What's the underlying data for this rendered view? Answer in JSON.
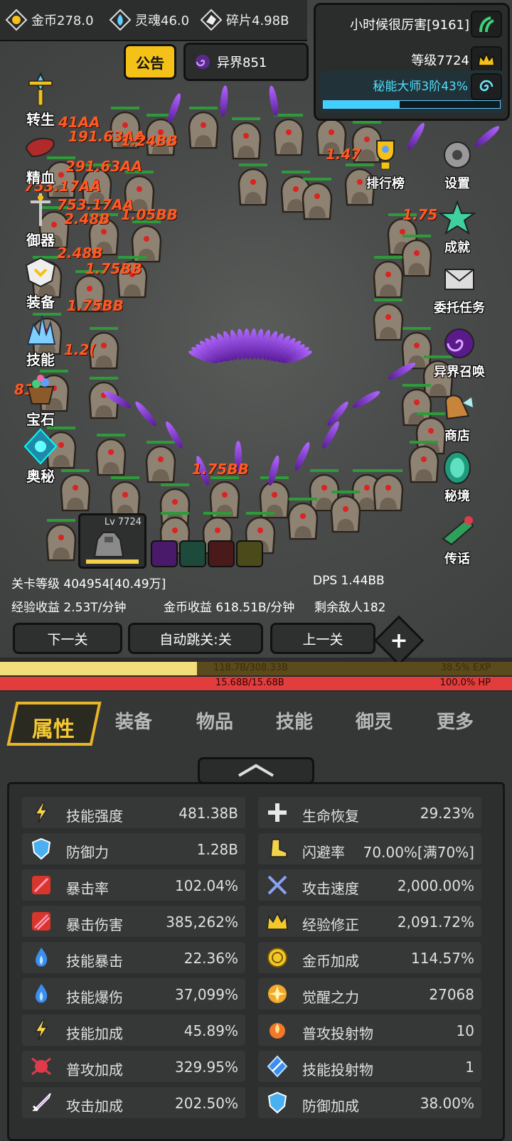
{
  "resources": [
    {
      "icon": "gold-coin-icon",
      "text": "金币278.0"
    },
    {
      "icon": "soul-icon",
      "text": "灵魂46.0"
    },
    {
      "icon": "fragment-icon",
      "text": "碎片4.98B"
    }
  ],
  "boss": {
    "title": "小时候很厉害[9161]",
    "level": "等级7724",
    "rank": "秘能大师3阶43%",
    "progress": 0.43
  },
  "notice_label": "公告",
  "otherworld_label": "异界851",
  "left_menu": [
    "转生",
    "精血",
    "御器",
    "装备",
    "技能",
    "宝石",
    "奥秘"
  ],
  "right_menu": [
    "排行榜",
    "设置",
    "成就",
    "委托任务",
    "异界召唤",
    "商店",
    "秘境",
    "传话"
  ],
  "damage_numbers": [
    "41AA",
    "191.63AA",
    "1.24BB",
    "291.63AA",
    "753.17AA",
    "753.17AA",
    "2.48B",
    "1.05BB",
    "2.48B",
    "1.75BB",
    "1.75BB",
    "1.75BB",
    "818",
    "1.2(",
    "1.47",
    "1.75"
  ],
  "hero": {
    "level": "Lv 7724"
  },
  "stage": {
    "level": "关卡等级 404954[40.49万]",
    "dps": "DPS 1.44BB",
    "exp_rate": "经验收益 2.53T/分钟",
    "gold_rate": "金币收益 618.51B/分钟",
    "enemies_left": "剩余敌人182"
  },
  "nav": {
    "next": "下一关",
    "auto": "自动跳关:关",
    "prev": "上一关",
    "plus": "+"
  },
  "exp_bar": {
    "value": "118.7B/308.33B",
    "percent": "38.5% EXP",
    "fraction": 0.385
  },
  "hp_bar": {
    "value": "15.68B/15.68B",
    "percent": "100.0%  HP",
    "fraction": 1.0
  },
  "tabs": [
    "属性",
    "装备",
    "物品",
    "技能",
    "御灵",
    "更多"
  ],
  "stats_left": [
    {
      "label": "技能强度",
      "value": "481.38B",
      "icon": "lightning-icon",
      "color": "#f2d24a"
    },
    {
      "label": "防御力",
      "value": "1.28B",
      "icon": "shield-icon",
      "color": "#4ab0f2"
    },
    {
      "label": "暴击率",
      "value": "102.04%",
      "icon": "crit-slash-icon",
      "color": "#d9362b"
    },
    {
      "label": "暴击伤害",
      "value": "385,262%",
      "icon": "crit-damage-icon",
      "color": "#d9362b"
    },
    {
      "label": "技能暴击",
      "value": "22.36%",
      "icon": "blue-flame-icon",
      "color": "#3c8ff2"
    },
    {
      "label": "技能爆伤",
      "value": "37,099%",
      "icon": "blue-flame-icon",
      "color": "#3c8ff2"
    },
    {
      "label": "技能加成",
      "value": "45.89%",
      "icon": "lightning-icon",
      "color": "#f2d24a"
    },
    {
      "label": "普攻加成",
      "value": "329.95%",
      "icon": "splash-icon",
      "color": "#e23a4a"
    },
    {
      "label": "攻击加成",
      "value": "202.50%",
      "icon": "sword-icon",
      "color": "#c48cf2"
    }
  ],
  "stats_right": [
    {
      "label": "生命恢复",
      "value": "29.23%",
      "icon": "heal-plus-icon",
      "color": "#e8e8e8"
    },
    {
      "label": "闪避率",
      "value": "70.00%[满70%]",
      "icon": "boot-icon",
      "color": "#f2d24a"
    },
    {
      "label": "攻击速度",
      "value": "2,000.00%",
      "icon": "crossed-swords-icon",
      "color": "#8aa0f2"
    },
    {
      "label": "经验修正",
      "value": "2,091.72%",
      "icon": "crown-icon",
      "color": "#f2c82a"
    },
    {
      "label": "金币加成",
      "value": "114.57%",
      "icon": "coin-icon",
      "color": "#f2c82a"
    },
    {
      "label": "觉醒之力",
      "value": "27068",
      "icon": "awaken-icon",
      "color": "#f2a82a"
    },
    {
      "label": "普攻投射物",
      "value": "10",
      "icon": "fire-orb-icon",
      "color": "#f2782a"
    },
    {
      "label": "技能投射物",
      "value": "1",
      "icon": "arrow-gem-icon",
      "color": "#3c8ff2"
    },
    {
      "label": "防御加成",
      "value": "38.00%",
      "icon": "shield-icon",
      "color": "#4ab0f2"
    }
  ]
}
